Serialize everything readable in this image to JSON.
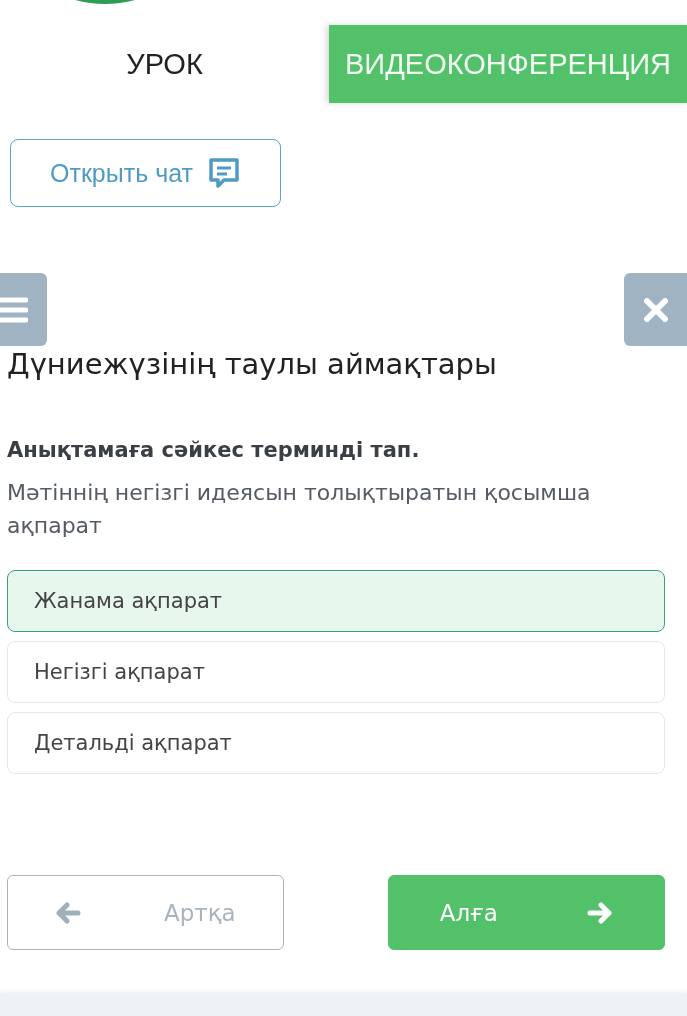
{
  "tabs": [
    {
      "label": "УРОК",
      "selected": false
    },
    {
      "label": "ВИДЕОКОНФЕРЕНЦИЯ",
      "selected": true
    }
  ],
  "chat_button": {
    "label": "Открыть чат"
  },
  "lesson_title": "Дүниежүзінің таулы аймақтары",
  "question": {
    "prompt": "Анықтамаға сәйкес терминді тап.",
    "definition": "Мәтіннің негізгі идеясын толықтыратын қосымша ақпарат"
  },
  "options": [
    {
      "label": "Жанама ақпарат",
      "selected": true
    },
    {
      "label": "Негізгі ақпарат",
      "selected": false
    },
    {
      "label": "Детальді ақпарат",
      "selected": false
    }
  ],
  "navigation": {
    "back": {
      "label": "Артқа",
      "disabled": true
    },
    "next": {
      "label": "Алға",
      "disabled": false
    }
  }
}
